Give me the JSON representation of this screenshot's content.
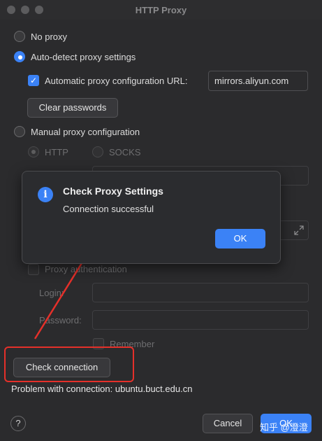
{
  "window": {
    "title": "HTTP Proxy"
  },
  "options": {
    "no_proxy": "No proxy",
    "auto_detect": "Auto-detect proxy settings",
    "auto_config_label": "Automatic proxy configuration URL:",
    "auto_config_value": "mirrors.aliyun.com",
    "clear_passwords": "Clear passwords",
    "manual": "Manual proxy configuration",
    "http": "HTTP",
    "socks": "SOCKS"
  },
  "auth": {
    "proxy_auth": "Proxy authentication",
    "login": "Login:",
    "password": "Password:",
    "remember": "Remember"
  },
  "dialog": {
    "title": "Check Proxy Settings",
    "message": "Connection successful",
    "ok": "OK",
    "icon": "info-icon"
  },
  "footer": {
    "check_connection": "Check connection",
    "problem": "Problem with connection: ubuntu.buct.edu.cn",
    "help": "?",
    "cancel": "Cancel",
    "ok": "OK",
    "watermark": "知乎 @澄澄"
  },
  "colors": {
    "accent": "#3b82f6",
    "annotation": "#e5302a",
    "background": "#2b2b2d"
  }
}
